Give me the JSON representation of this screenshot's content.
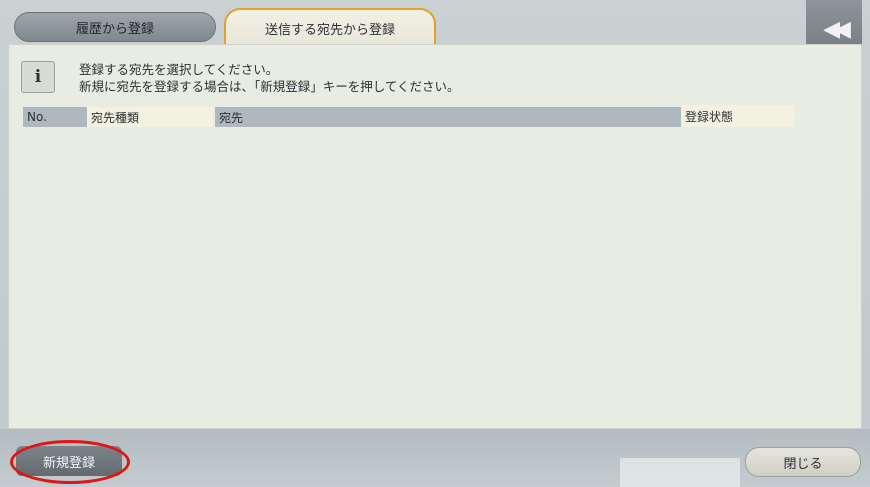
{
  "tabs": {
    "history": "履歴から登録",
    "send_destination": "送信する宛先から登録"
  },
  "back_button": {
    "icon": "rewind-icon",
    "glyph": "◀◀"
  },
  "info": {
    "icon_glyph": "i",
    "line1": "登録する宛先を選択してください。",
    "line2": "新規に宛先を登録する場合は、「新規登録」キーを押してください。"
  },
  "table": {
    "columns": [
      "No.",
      "宛先種類",
      "宛先",
      "登録状態"
    ]
  },
  "footer": {
    "new_register": "新規登録",
    "close": "閉じる"
  },
  "colors": {
    "active_tab_border": "#e1a12c",
    "highlight_circle": "#e01515"
  }
}
